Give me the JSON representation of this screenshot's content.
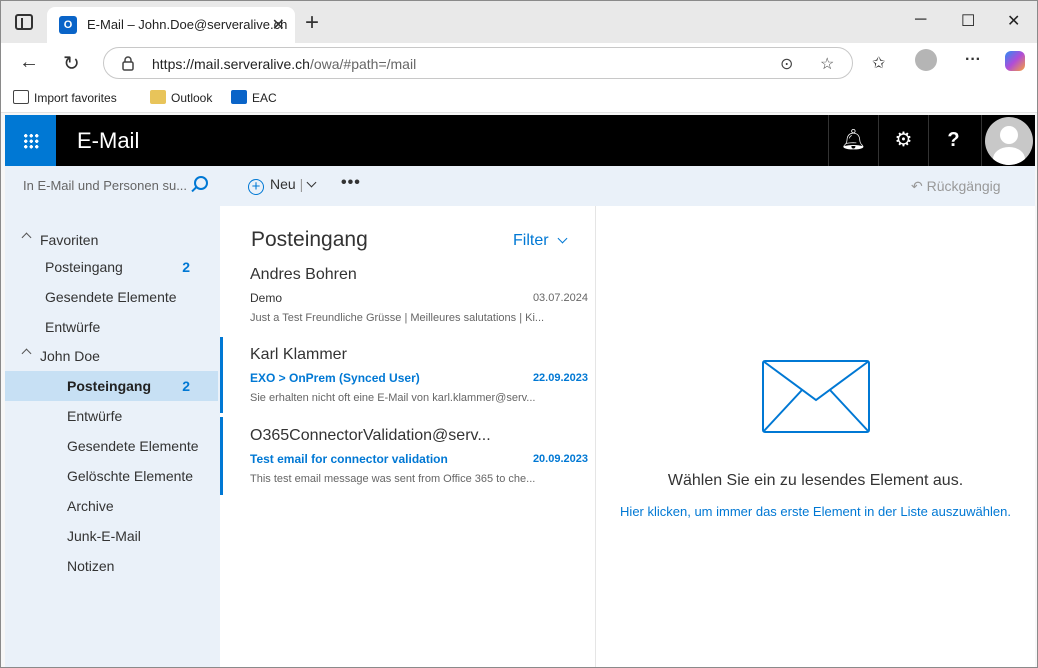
{
  "browser": {
    "tab_title": "E-Mail – John.Doe@serveralive.ch",
    "tab_favicon": "O",
    "url_host": "https://mail.serveralive.ch",
    "url_path": "/owa/#path=/mail",
    "bookmarks": [
      {
        "label": "Import favorites",
        "icon": "import-icon"
      },
      {
        "label": "Outlook",
        "icon": "outlook-folder-icon"
      },
      {
        "label": "EAC",
        "icon": "outlook-icon"
      }
    ]
  },
  "owa": {
    "app_title": "E-Mail",
    "search_placeholder": "In E-Mail und Personen su...",
    "new_label": "Neu",
    "undo_label": "Rückgängig",
    "accent": "#0078d4"
  },
  "nav": {
    "favorites_header": "Favoriten",
    "favorites": [
      {
        "label": "Posteingang",
        "count": "2"
      },
      {
        "label": "Gesendete Elemente",
        "count": ""
      },
      {
        "label": "Entwürfe",
        "count": ""
      }
    ],
    "account_header": "John Doe",
    "folders": [
      {
        "label": "Posteingang",
        "count": "2"
      },
      {
        "label": "Entwürfe",
        "count": ""
      },
      {
        "label": "Gesendete Elemente",
        "count": ""
      },
      {
        "label": "Gelöschte Elemente",
        "count": ""
      },
      {
        "label": "Archive",
        "count": ""
      },
      {
        "label": "Junk-E-Mail",
        "count": ""
      },
      {
        "label": "Notizen",
        "count": ""
      }
    ]
  },
  "list": {
    "title": "Posteingang",
    "filter_label": "Filter",
    "messages": [
      {
        "from": "Andres Bohren",
        "subject": "Demo",
        "date": "03.07.2024",
        "preview": "Just a Test Freundliche Grüsse | Meilleures salutations | Ki...",
        "unread": false
      },
      {
        "from": "Karl Klammer",
        "subject": "EXO > OnPrem (Synced User)",
        "date": "22.09.2023",
        "preview": "Sie erhalten nicht oft eine E-Mail von karl.klammer@serv...",
        "unread": true
      },
      {
        "from": "O365ConnectorValidation@serv...",
        "subject": "Test email for connector validation",
        "date": "20.09.2023",
        "preview": "This test email message was sent from Office 365 to che...",
        "unread": true
      }
    ]
  },
  "reading": {
    "empty_message": "Wählen Sie ein zu lesendes Element aus.",
    "link": "Hier klicken, um immer das erste Element in der Liste auszuwählen."
  }
}
